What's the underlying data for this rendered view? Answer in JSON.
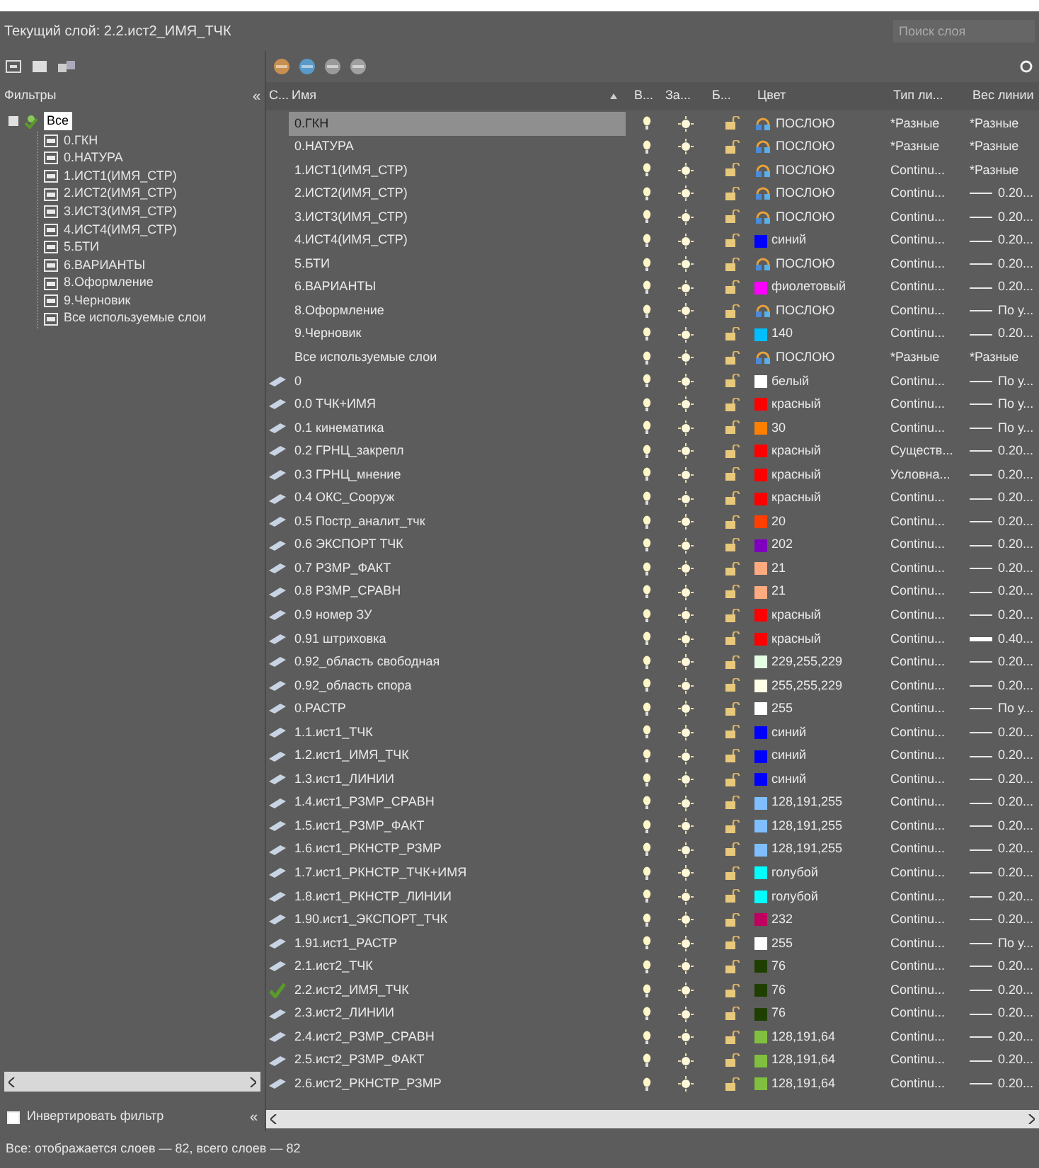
{
  "current_layer": "Текущий слой: 2.2.ист2_ИМЯ_ТЧК",
  "search": {
    "placeholder": "Поиск слоя"
  },
  "filters": {
    "title": "Фильтры",
    "collapse": "«",
    "root": {
      "label": "Все",
      "selected": true,
      "expanded": true,
      "children": [
        {
          "label": "0.ГКН"
        },
        {
          "label": "0.НАТУРА"
        },
        {
          "label": "1.ИСТ1(ИМЯ_СТР)"
        },
        {
          "label": "2.ИСТ2(ИМЯ_СТР)"
        },
        {
          "label": "3.ИСТ3(ИМЯ_СТР)"
        },
        {
          "label": "4.ИСТ4(ИМЯ_СТР)"
        },
        {
          "label": "5.БТИ"
        },
        {
          "label": "6.ВАРИАНТЫ"
        },
        {
          "label": "8.Оформление"
        },
        {
          "label": "9.Черновик"
        },
        {
          "label": "Все используемые слои"
        }
      ]
    },
    "invert": {
      "label": "Инвертировать фильтр",
      "checked": false
    },
    "collapse_bottom": "«"
  },
  "columns": [
    "С...",
    "Имя",
    "В...",
    "За...",
    "Б...",
    "Цвет",
    "Тип ли...",
    "Вес линии"
  ],
  "rows": [
    {
      "kind": "filter",
      "name": "0.ГКН",
      "selected": true,
      "color": {
        "kind": "bylayer",
        "name": "ПОСЛОЮ"
      },
      "linetype": "*Разные",
      "lineweight": {
        "kind": "text",
        "text": "*Разные"
      }
    },
    {
      "kind": "filter",
      "name": "0.НАТУРА",
      "selected": false,
      "color": {
        "kind": "bylayer",
        "name": "ПОСЛОЮ"
      },
      "linetype": "*Разные",
      "lineweight": {
        "kind": "text",
        "text": "*Разные"
      }
    },
    {
      "kind": "filter",
      "name": "1.ИСТ1(ИМЯ_СТР)",
      "selected": false,
      "color": {
        "kind": "bylayer",
        "name": "ПОСЛОЮ"
      },
      "linetype": "Continu...",
      "lineweight": {
        "kind": "text",
        "text": "*Разные"
      }
    },
    {
      "kind": "filter",
      "name": "2.ИСТ2(ИМЯ_СТР)",
      "selected": false,
      "color": {
        "kind": "bylayer",
        "name": "ПОСЛОЮ"
      },
      "linetype": "Continu...",
      "lineweight": {
        "kind": "thin",
        "text": "0.20..."
      }
    },
    {
      "kind": "filter",
      "name": "3.ИСТ3(ИМЯ_СТР)",
      "selected": false,
      "color": {
        "kind": "bylayer",
        "name": "ПОСЛОЮ"
      },
      "linetype": "Continu...",
      "lineweight": {
        "kind": "thin",
        "text": "0.20..."
      }
    },
    {
      "kind": "filter",
      "name": "4.ИСТ4(ИМЯ_СТР)",
      "selected": false,
      "color": {
        "kind": "swatch",
        "color": "#0000ff",
        "name": "синий"
      },
      "linetype": "Continu...",
      "lineweight": {
        "kind": "thin",
        "text": "0.20..."
      }
    },
    {
      "kind": "filter",
      "name": "5.БТИ",
      "selected": false,
      "color": {
        "kind": "bylayer",
        "name": "ПОСЛОЮ"
      },
      "linetype": "Continu...",
      "lineweight": {
        "kind": "thin",
        "text": "0.20..."
      }
    },
    {
      "kind": "filter",
      "name": "6.ВАРИАНТЫ",
      "selected": false,
      "color": {
        "kind": "swatch",
        "color": "#ff00ff",
        "name": "фиолетовый"
      },
      "linetype": "Continu...",
      "lineweight": {
        "kind": "thin",
        "text": "0.20..."
      }
    },
    {
      "kind": "filter",
      "name": "8.Оформление",
      "selected": false,
      "color": {
        "kind": "bylayer",
        "name": "ПОСЛОЮ"
      },
      "linetype": "Continu...",
      "lineweight": {
        "kind": "thin",
        "text": "По у..."
      }
    },
    {
      "kind": "filter",
      "name": "9.Черновик",
      "selected": false,
      "color": {
        "kind": "swatch",
        "color": "#00bfff",
        "name": "140"
      },
      "linetype": "Continu...",
      "lineweight": {
        "kind": "thin",
        "text": "0.20..."
      }
    },
    {
      "kind": "filter",
      "name": "Все используемые слои",
      "selected": false,
      "color": {
        "kind": "bylayer",
        "name": "ПОСЛОЮ"
      },
      "linetype": "*Разные",
      "lineweight": {
        "kind": "text",
        "text": "*Разные"
      }
    },
    {
      "kind": "layer",
      "name": "0",
      "selected": false,
      "color": {
        "kind": "swatch",
        "color": "#ffffff",
        "name": "белый"
      },
      "linetype": "Continu...",
      "lineweight": {
        "kind": "thin",
        "text": "По у..."
      }
    },
    {
      "kind": "layer",
      "name": "0.0 ТЧК+ИМЯ",
      "selected": false,
      "color": {
        "kind": "swatch",
        "color": "#ff0000",
        "name": "красный"
      },
      "linetype": "Continu...",
      "lineweight": {
        "kind": "thin",
        "text": "По у..."
      }
    },
    {
      "kind": "layer",
      "name": "0.1 кинематика",
      "selected": false,
      "color": {
        "kind": "swatch",
        "color": "#ff7f00",
        "name": "30"
      },
      "linetype": "Continu...",
      "lineweight": {
        "kind": "thin",
        "text": "По у..."
      }
    },
    {
      "kind": "layer",
      "name": "0.2 ГРНЦ_закрепл",
      "selected": false,
      "color": {
        "kind": "swatch",
        "color": "#ff0000",
        "name": "красный"
      },
      "linetype": "Существ...",
      "lineweight": {
        "kind": "thin",
        "text": "0.20..."
      }
    },
    {
      "kind": "layer",
      "name": "0.3 ГРНЦ_мнение",
      "selected": false,
      "color": {
        "kind": "swatch",
        "color": "#ff0000",
        "name": "красный"
      },
      "linetype": "Условна...",
      "lineweight": {
        "kind": "thin",
        "text": "0.20..."
      }
    },
    {
      "kind": "layer",
      "name": "0.4 ОКС_Сооруж",
      "selected": false,
      "color": {
        "kind": "swatch",
        "color": "#ff0000",
        "name": "красный"
      },
      "linetype": "Continu...",
      "lineweight": {
        "kind": "thin",
        "text": "0.20..."
      }
    },
    {
      "kind": "layer",
      "name": "0.5 Постр_аналит_тчк",
      "selected": false,
      "color": {
        "kind": "swatch",
        "color": "#ff3f00",
        "name": "20"
      },
      "linetype": "Continu...",
      "lineweight": {
        "kind": "thin",
        "text": "0.20..."
      }
    },
    {
      "kind": "layer",
      "name": "0.6 ЭКСПОРТ ТЧК",
      "selected": false,
      "color": {
        "kind": "swatch",
        "color": "#7f00bf",
        "name": "202"
      },
      "linetype": "Continu...",
      "lineweight": {
        "kind": "thin",
        "text": "0.20..."
      }
    },
    {
      "kind": "layer",
      "name": "0.7 РЗМР_ФАКТ",
      "selected": false,
      "color": {
        "kind": "swatch",
        "color": "#ffaa7f",
        "name": "21"
      },
      "linetype": "Continu...",
      "lineweight": {
        "kind": "thin",
        "text": "0.20..."
      }
    },
    {
      "kind": "layer",
      "name": "0.8 РЗМР_СРАВН",
      "selected": false,
      "color": {
        "kind": "swatch",
        "color": "#ffaa7f",
        "name": "21"
      },
      "linetype": "Continu...",
      "lineweight": {
        "kind": "thin",
        "text": "0.20..."
      }
    },
    {
      "kind": "layer",
      "name": "0.9 номер ЗУ",
      "selected": false,
      "color": {
        "kind": "swatch",
        "color": "#ff0000",
        "name": "красный"
      },
      "linetype": "Continu...",
      "lineweight": {
        "kind": "thin",
        "text": "0.20..."
      }
    },
    {
      "kind": "layer",
      "name": "0.91 штриховка",
      "selected": false,
      "color": {
        "kind": "swatch",
        "color": "#ff0000",
        "name": "красный"
      },
      "linetype": "Continu...",
      "lineweight": {
        "kind": "thick",
        "text": "0.40..."
      }
    },
    {
      "kind": "layer",
      "name": "0.92_область свободная",
      "selected": false,
      "color": {
        "kind": "swatch",
        "color": "#e5ffe5",
        "name": "229,255,229"
      },
      "linetype": "Continu...",
      "lineweight": {
        "kind": "thin",
        "text": "0.20..."
      }
    },
    {
      "kind": "layer",
      "name": "0.92_область спора",
      "selected": false,
      "color": {
        "kind": "swatch",
        "color": "#ffffe5",
        "name": "255,255,229"
      },
      "linetype": "Continu...",
      "lineweight": {
        "kind": "thin",
        "text": "0.20..."
      }
    },
    {
      "kind": "layer",
      "name": "0.РАСТР",
      "selected": false,
      "color": {
        "kind": "swatch",
        "color": "#ffffff",
        "name": "255"
      },
      "linetype": "Continu...",
      "lineweight": {
        "kind": "thin",
        "text": "По у..."
      }
    },
    {
      "kind": "layer",
      "name": "1.1.ист1_ТЧК",
      "selected": false,
      "color": {
        "kind": "swatch",
        "color": "#0000ff",
        "name": "синий"
      },
      "linetype": "Continu...",
      "lineweight": {
        "kind": "thin",
        "text": "0.20..."
      }
    },
    {
      "kind": "layer",
      "name": "1.2.ист1_ИМЯ_ТЧК",
      "selected": false,
      "color": {
        "kind": "swatch",
        "color": "#0000ff",
        "name": "синий"
      },
      "linetype": "Continu...",
      "lineweight": {
        "kind": "thin",
        "text": "0.20..."
      }
    },
    {
      "kind": "layer",
      "name": "1.3.ист1_ЛИНИИ",
      "selected": false,
      "color": {
        "kind": "swatch",
        "color": "#0000ff",
        "name": "синий"
      },
      "linetype": "Continu...",
      "lineweight": {
        "kind": "thin",
        "text": "0.20..."
      }
    },
    {
      "kind": "layer",
      "name": "1.4.ист1_РЗМР_СРАВН",
      "selected": false,
      "color": {
        "kind": "swatch",
        "color": "#80bfff",
        "name": "128,191,255"
      },
      "linetype": "Continu...",
      "lineweight": {
        "kind": "thin",
        "text": "0.20..."
      }
    },
    {
      "kind": "layer",
      "name": "1.5.ист1_РЗМР_ФАКТ",
      "selected": false,
      "color": {
        "kind": "swatch",
        "color": "#80bfff",
        "name": "128,191,255"
      },
      "linetype": "Continu...",
      "lineweight": {
        "kind": "thin",
        "text": "0.20..."
      }
    },
    {
      "kind": "layer",
      "name": "1.6.ист1_РКНСТР_РЗМР",
      "selected": false,
      "color": {
        "kind": "swatch",
        "color": "#80bfff",
        "name": "128,191,255"
      },
      "linetype": "Continu...",
      "lineweight": {
        "kind": "thin",
        "text": "0.20..."
      }
    },
    {
      "kind": "layer",
      "name": "1.7.ист1_РКНСТР_ТЧК+ИМЯ",
      "selected": false,
      "color": {
        "kind": "swatch",
        "color": "#00ffff",
        "name": "голубой"
      },
      "linetype": "Continu...",
      "lineweight": {
        "kind": "thin",
        "text": "0.20..."
      }
    },
    {
      "kind": "layer",
      "name": "1.8.ист1_РКНСТР_ЛИНИИ",
      "selected": false,
      "color": {
        "kind": "swatch",
        "color": "#00ffff",
        "name": "голубой"
      },
      "linetype": "Continu...",
      "lineweight": {
        "kind": "thin",
        "text": "0.20..."
      }
    },
    {
      "kind": "layer",
      "name": "1.90.ист1_ЭКСПОРТ_ТЧК",
      "selected": false,
      "color": {
        "kind": "swatch",
        "color": "#bf005f",
        "name": "232"
      },
      "linetype": "Continu...",
      "lineweight": {
        "kind": "thin",
        "text": "0.20..."
      }
    },
    {
      "kind": "layer",
      "name": "1.91.ист1_РАСТР",
      "selected": false,
      "color": {
        "kind": "swatch",
        "color": "#ffffff",
        "name": "255"
      },
      "linetype": "Continu...",
      "lineweight": {
        "kind": "thin",
        "text": "По у..."
      }
    },
    {
      "kind": "layer",
      "name": "2.1.ист2_ТЧК",
      "selected": false,
      "color": {
        "kind": "swatch",
        "color": "#1f3f00",
        "name": "76"
      },
      "linetype": "Continu...",
      "lineweight": {
        "kind": "thin",
        "text": "0.20..."
      }
    },
    {
      "kind": "current",
      "name": "2.2.ист2_ИМЯ_ТЧК",
      "selected": false,
      "color": {
        "kind": "swatch",
        "color": "#1f3f00",
        "name": "76"
      },
      "linetype": "Continu...",
      "lineweight": {
        "kind": "thin",
        "text": "0.20..."
      }
    },
    {
      "kind": "layer",
      "name": "2.3.ист2_ЛИНИИ",
      "selected": false,
      "color": {
        "kind": "swatch",
        "color": "#1f3f00",
        "name": "76"
      },
      "linetype": "Continu...",
      "lineweight": {
        "kind": "thin",
        "text": "0.20..."
      }
    },
    {
      "kind": "layer",
      "name": "2.4.ист2_РЗМР_СРАВН",
      "selected": false,
      "color": {
        "kind": "swatch",
        "color": "#80bf40",
        "name": "128,191,64"
      },
      "linetype": "Continu...",
      "lineweight": {
        "kind": "thin",
        "text": "0.20..."
      }
    },
    {
      "kind": "layer",
      "name": "2.5.ист2_РЗМР_ФАКТ",
      "selected": false,
      "color": {
        "kind": "swatch",
        "color": "#80bf40",
        "name": "128,191,64"
      },
      "linetype": "Continu...",
      "lineweight": {
        "kind": "thin",
        "text": "0.20..."
      }
    },
    {
      "kind": "layer",
      "name": "2.6.ист2_РКНСТР_РЗМР",
      "selected": false,
      "color": {
        "kind": "swatch",
        "color": "#80bf40",
        "name": "128,191,64"
      },
      "linetype": "Continu...",
      "lineweight": {
        "kind": "thin",
        "text": "0.20..."
      }
    }
  ],
  "status_bar": "Все: отображается слоев — 82, всего слоев — 82"
}
